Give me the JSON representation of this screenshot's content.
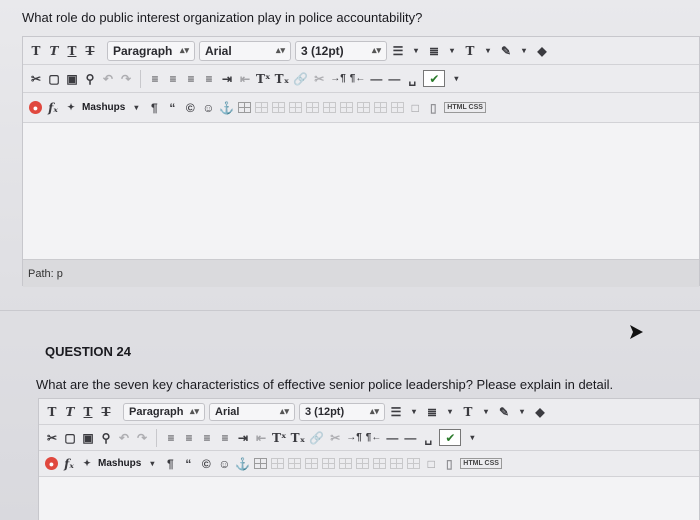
{
  "question_prev": {
    "text": "What role do public interest organization play in police accountability?"
  },
  "question24": {
    "header": "QUESTION 24",
    "text": "What are the seven key characteristics of effective senior police leadership? Please explain in detail."
  },
  "toolbar": {
    "format_buttons": [
      "T",
      "T",
      "T",
      "T"
    ],
    "paragraph_select": "Paragraph",
    "font_select": "Arial",
    "size_select": "3 (12pt)",
    "text_color_label": "T",
    "superscript_label": "Tˣ",
    "subscript_label": "Tₓ",
    "mashups_label": "Mashups",
    "html_css_label": "HTML CSS",
    "function_label": "fₓ"
  },
  "editor1": {
    "path_label": "Path: p"
  },
  "colors": {
    "accent_red": "#e0483e",
    "toolbar_bg": "#ececef",
    "path_bg": "#dadadd"
  }
}
